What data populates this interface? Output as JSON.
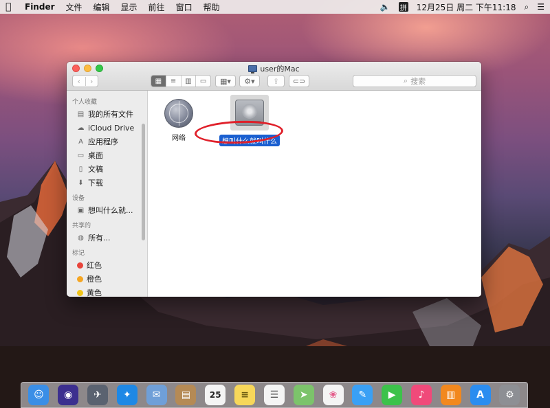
{
  "menubar": {
    "app_name": "Finder",
    "items": [
      "文件",
      "编辑",
      "显示",
      "前往",
      "窗口",
      "帮助"
    ],
    "ime_label": "拼",
    "clock": "12月25日 周二 下午11:18"
  },
  "window": {
    "title": "user的Mac",
    "search_placeholder": "搜索"
  },
  "sidebar": {
    "favorites_title": "个人收藏",
    "favorites": [
      {
        "label": "我的所有文件",
        "icon": "all-files-icon"
      },
      {
        "label": "iCloud Drive",
        "icon": "cloud-icon"
      },
      {
        "label": "应用程序",
        "icon": "applications-icon"
      },
      {
        "label": "桌面",
        "icon": "desktop-icon"
      },
      {
        "label": "文稿",
        "icon": "documents-icon"
      },
      {
        "label": "下载",
        "icon": "download-icon"
      }
    ],
    "devices_title": "设备",
    "devices": [
      {
        "label": "想叫什么就...",
        "icon": "disk-icon"
      }
    ],
    "shared_title": "共享的",
    "shared": [
      {
        "label": "所有...",
        "icon": "network-icon"
      }
    ],
    "tags_title": "标记",
    "tags": [
      {
        "label": "红色",
        "color": "#e8453c"
      },
      {
        "label": "橙色",
        "color": "#f5a623"
      },
      {
        "label": "黄色",
        "color": "#f0c419"
      }
    ]
  },
  "files": [
    {
      "label": "网络",
      "icon": "network-globe-icon",
      "selected": false
    },
    {
      "label": "想叫什么就叫什么",
      "icon": "hard-disk-icon",
      "selected": true
    }
  ],
  "dock": {
    "items": [
      {
        "name": "finder",
        "color": "#3a8ee6",
        "glyph": "☺"
      },
      {
        "name": "siri",
        "color": "#3c2f8f",
        "glyph": "◉"
      },
      {
        "name": "launchpad",
        "color": "#5a6270",
        "glyph": "✈"
      },
      {
        "name": "safari",
        "color": "#1e88e5",
        "glyph": "✦"
      },
      {
        "name": "mail",
        "color": "#6f9fd8",
        "glyph": "✉"
      },
      {
        "name": "contacts",
        "color": "#b58a55",
        "glyph": "▤"
      },
      {
        "name": "calendar",
        "color": "#f4f4f4",
        "glyph": "25"
      },
      {
        "name": "notes",
        "color": "#f7d75a",
        "glyph": "≡"
      },
      {
        "name": "reminders",
        "color": "#f4f4f4",
        "glyph": "☰"
      },
      {
        "name": "maps",
        "color": "#7cc36b",
        "glyph": "➤"
      },
      {
        "name": "photos",
        "color": "#f4f4f4",
        "glyph": "❀"
      },
      {
        "name": "messages",
        "color": "#3aa0f5",
        "glyph": "💬"
      },
      {
        "name": "facetime",
        "color": "#3cc24a",
        "glyph": "▶"
      },
      {
        "name": "music",
        "color": "#f04a7a",
        "glyph": "♪"
      },
      {
        "name": "books",
        "color": "#f2881e",
        "glyph": "▥"
      },
      {
        "name": "app-store",
        "color": "#2b8df0",
        "glyph": "A"
      },
      {
        "name": "system-preferences",
        "color": "#8d8f94",
        "glyph": "⚙"
      }
    ]
  }
}
